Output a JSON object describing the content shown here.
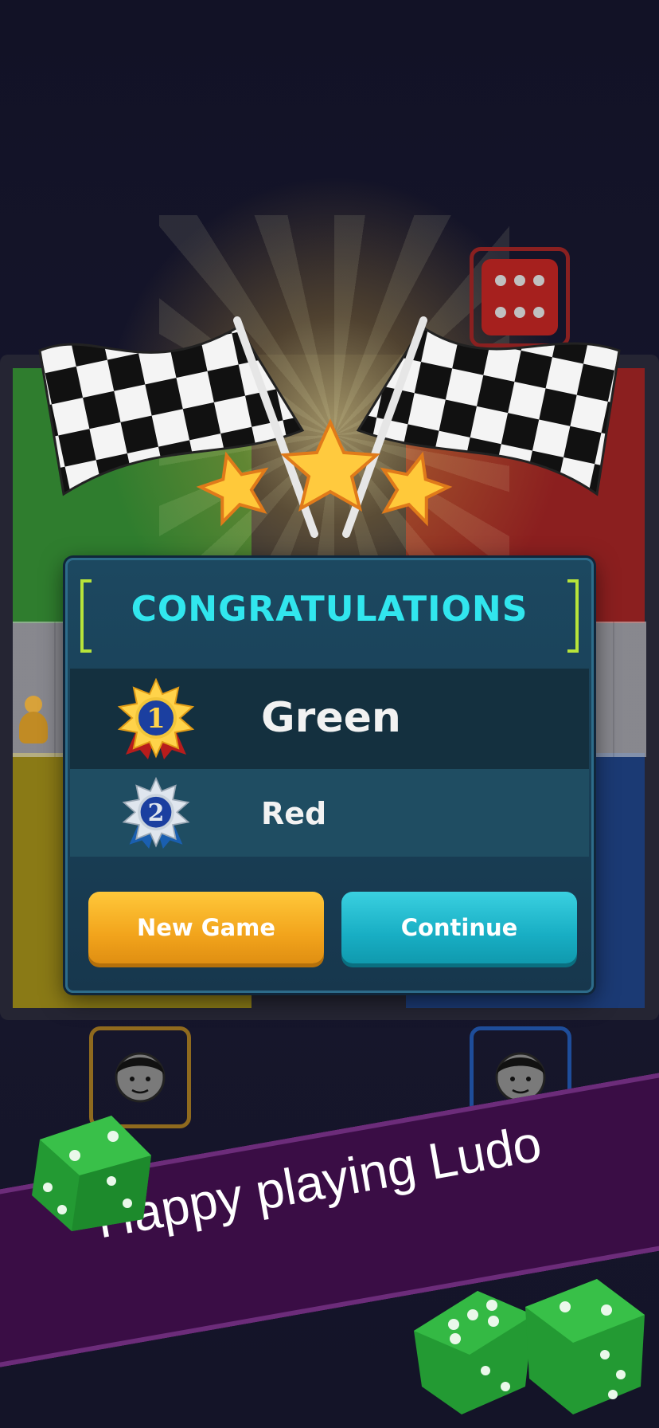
{
  "dialog": {
    "title": "CONGRATULATIONS",
    "results": [
      {
        "rank": "1",
        "player": "Green"
      },
      {
        "rank": "2",
        "player": "Red"
      }
    ],
    "buttons": {
      "new_game": "New Game",
      "continue": "Continue"
    }
  },
  "banner": {
    "text": "Happy playing Ludo"
  },
  "colors": {
    "title": "#31e6ee",
    "new_game_button": "#f2a41c",
    "continue_button": "#18aec4",
    "banner": "#3a0d45",
    "dice": "#2aa83a"
  },
  "icons": [
    "checkered-flag-icon",
    "star-icon",
    "gold-medal-icon",
    "silver-medal-icon",
    "player-avatar-icon",
    "dice-icon",
    "pawn-icon"
  ]
}
